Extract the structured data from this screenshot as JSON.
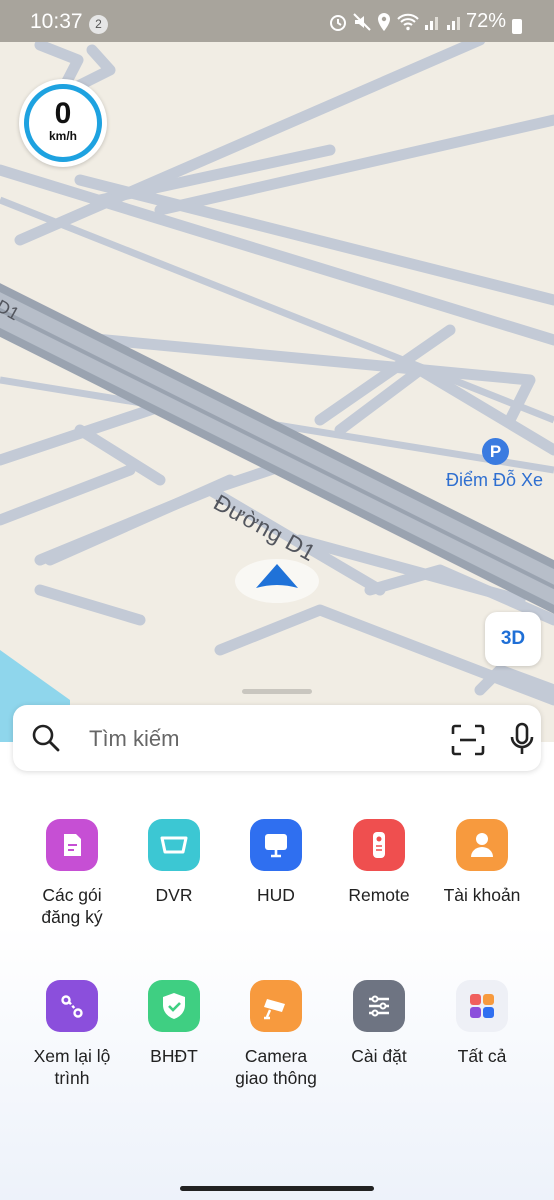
{
  "status_bar": {
    "time": "10:37",
    "notification_count": "2",
    "icons": [
      "alarm-icon",
      "mute-icon",
      "location-icon",
      "wifi-icon",
      "signal-icon",
      "signal-icon"
    ],
    "battery": "72%"
  },
  "map": {
    "speed": {
      "value": "0",
      "unit": "km/h"
    },
    "road_label": "Đường D1",
    "edge_label": "D1",
    "poi": {
      "label": "Điểm Đỗ Xe",
      "pin_letter": "P"
    },
    "view_mode_button": "3D"
  },
  "search": {
    "placeholder": "Tìm kiếm"
  },
  "menu": [
    {
      "label": "Các gói\nđăng ký",
      "icon": "document-icon",
      "color": "#c64fd4"
    },
    {
      "label": "DVR",
      "icon": "dvr-icon",
      "color": "#3cc7d3"
    },
    {
      "label": "HUD",
      "icon": "monitor-icon",
      "color": "#2f6ff0"
    },
    {
      "label": "Remote",
      "icon": "remote-icon",
      "color": "#ef4f4f"
    },
    {
      "label": "Tài khoản",
      "icon": "person-icon",
      "color": "#f79a3e"
    },
    {
      "label": "Xem lại lộ\ntrình",
      "icon": "route-icon",
      "color": "#8b4fdc"
    },
    {
      "label": "BHĐT",
      "icon": "shield-icon",
      "color": "#3fcf82"
    },
    {
      "label": "Camera\ngiao thông",
      "icon": "camera-icon",
      "color": "#f79a3e"
    },
    {
      "label": "Cài đặt",
      "icon": "settings-sliders-icon",
      "color": "#6e7482"
    },
    {
      "label": "Tất cả",
      "icon": "apps-grid-icon",
      "color": "#eef0f6"
    }
  ]
}
